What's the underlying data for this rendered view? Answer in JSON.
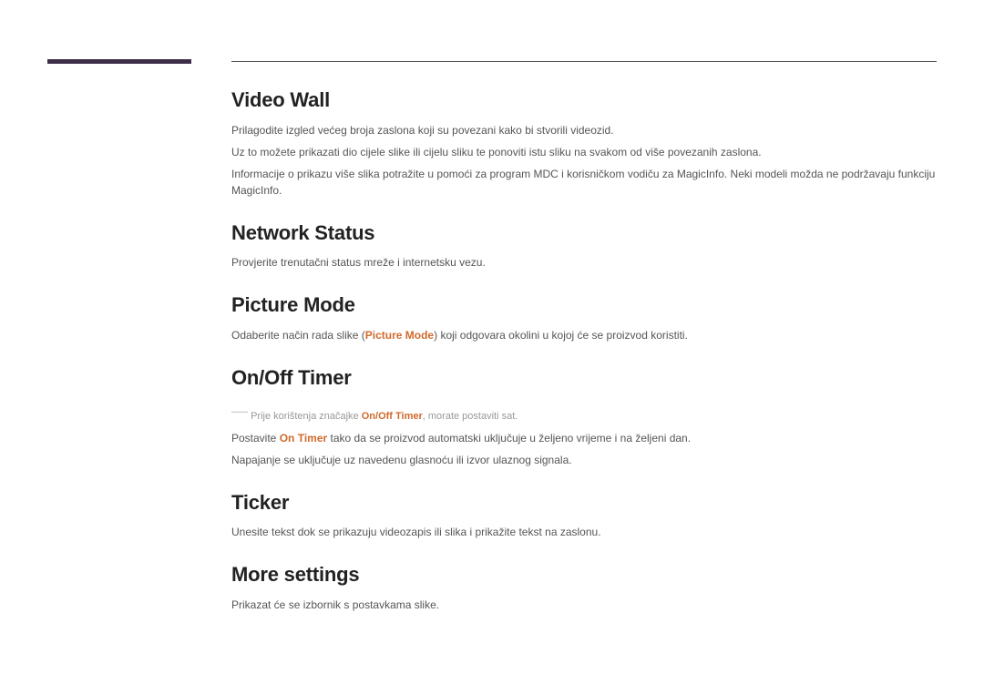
{
  "sections": {
    "videoWall": {
      "title": "Video Wall",
      "p1": "Prilagodite izgled većeg broja zaslona koji su povezani kako bi stvorili videozid.",
      "p2": "Uz to možete prikazati dio cijele slike ili cijelu sliku te ponoviti istu sliku na svakom od više povezanih zaslona.",
      "p3": "Informacije o prikazu više slika potražite u pomoći za program MDC i korisničkom vodiču za MagicInfo. Neki modeli možda ne podržavaju funkciju MagicInfo."
    },
    "networkStatus": {
      "title": "Network Status",
      "p1": "Provjerite trenutačni status mreže i internetsku vezu."
    },
    "pictureMode": {
      "title": "Picture Mode",
      "p1_pre": "Odaberite način rada slike (",
      "p1_hl": "Picture Mode",
      "p1_post": ") koji odgovara okolini u kojoj će se proizvod koristiti."
    },
    "onOffTimer": {
      "title": "On/Off Timer",
      "note_pre": "Prije korištenja značajke ",
      "note_hl": "On/Off Timer",
      "note_post": ", morate postaviti sat.",
      "p2_pre": "Postavite ",
      "p2_hl": "On Timer",
      "p2_post": " tako da se proizvod automatski uključuje u željeno vrijeme i na željeni dan.",
      "p3": "Napajanje se uključuje uz navedenu glasnoću ili izvor ulaznog signala."
    },
    "ticker": {
      "title": "Ticker",
      "p1": "Unesite tekst dok se prikazuju videozapis ili slika i prikažite tekst na zaslonu."
    },
    "moreSettings": {
      "title": "More settings",
      "p1": "Prikazat će se izbornik s postavkama slike."
    }
  }
}
